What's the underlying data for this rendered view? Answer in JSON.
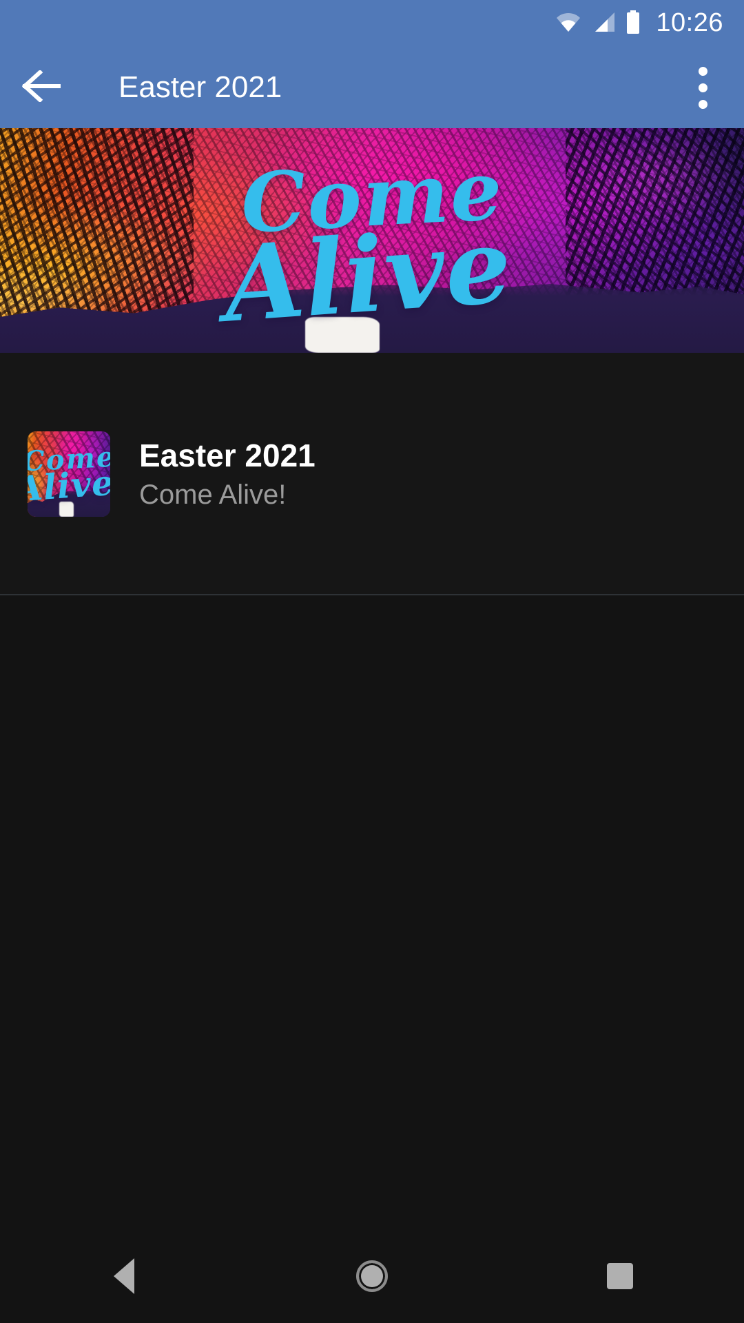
{
  "status_bar": {
    "time": "10:26",
    "icons": [
      "wifi-icon",
      "cellular-signal-icon",
      "battery-icon"
    ],
    "wifi_level": "partial",
    "cellular_level": "partial",
    "battery_level": "full"
  },
  "app_bar": {
    "title": "Easter 2021",
    "back_icon": "back-arrow-icon",
    "overflow_icon": "more-vert-icon",
    "background_color": "#5179b8",
    "text_color": "#ffffff"
  },
  "hero": {
    "alt": "Come Alive artwork banner",
    "script_line_1": "Come",
    "script_line_2": "Alive",
    "script_color": "#35bdec"
  },
  "list": {
    "items": [
      {
        "thumbnail_alt": "Come Alive artwork thumbnail",
        "thumb_line_1": "Come",
        "thumb_line_2": "Alive",
        "title": "Easter 2021",
        "subtitle": "Come Alive!"
      }
    ]
  },
  "navigation_bar": {
    "back_label": "Back",
    "home_label": "Home",
    "recents_label": "Recents",
    "back_icon": "nav-back-triangle-icon",
    "home_icon": "nav-home-circle-icon",
    "recents_icon": "nav-recents-square-icon"
  },
  "theme": {
    "accent": "#5179b8",
    "background": "#131313",
    "surface": "#161616",
    "divider": "#2e3236",
    "title_text": "#ffffff",
    "secondary_text": "#9b9b9b"
  }
}
